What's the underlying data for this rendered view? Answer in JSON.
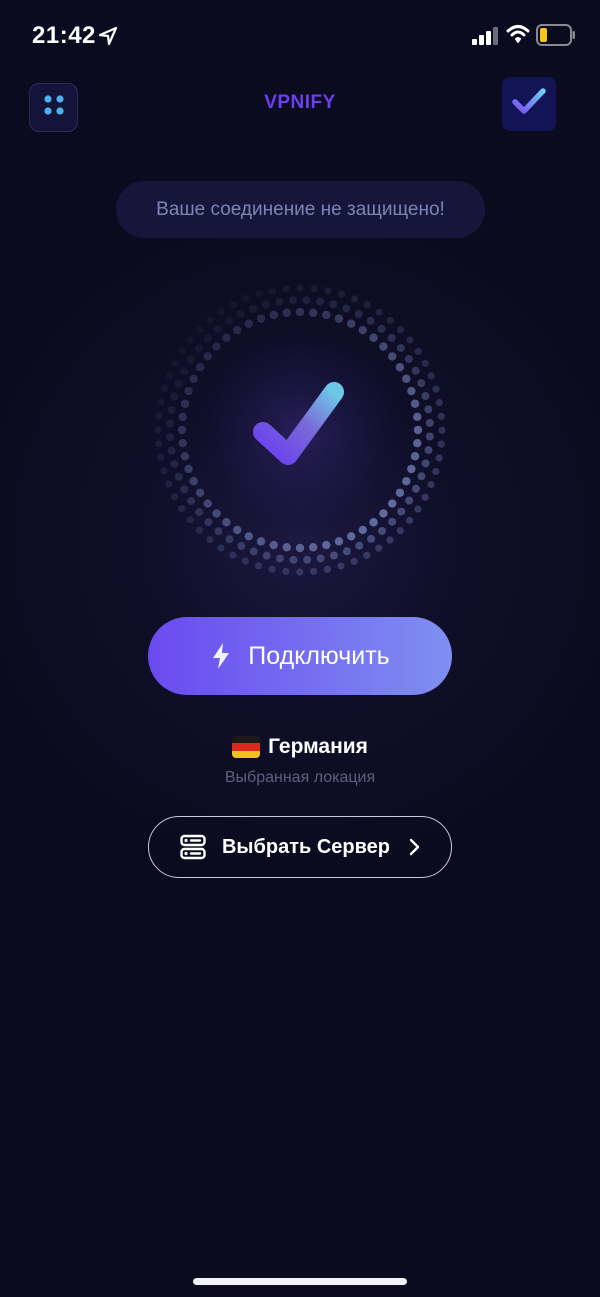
{
  "status_bar": {
    "time": "21:42",
    "icons": [
      "location-arrow-icon",
      "signal-icon",
      "wifi-icon",
      "battery-icon"
    ]
  },
  "header": {
    "title": "VPNIFY",
    "menu_icon": "grid-dots-icon",
    "premium_icon": "check-badge-icon"
  },
  "connection": {
    "status_text": "Ваше соединение не защищено!",
    "connect_label": "Подключить"
  },
  "location": {
    "country": "Германия",
    "caption": "Выбранная локация",
    "flag": "germany-flag"
  },
  "server": {
    "label": "Выбрать Сервер"
  },
  "colors": {
    "background": "#0b0b1f",
    "accent": "#6b3ef0",
    "button_gradient_start": "#6a4af0",
    "button_gradient_end": "#7f8ff0",
    "status_text": "#7b86b4"
  }
}
